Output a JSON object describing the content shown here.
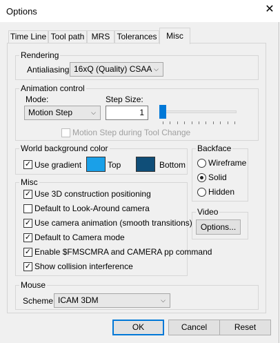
{
  "window": {
    "title": "Options",
    "close_glyph": "✕"
  },
  "tabs": [
    "Time Line",
    "Tool path",
    "MRS",
    "Tolerances",
    "Misc"
  ],
  "active_tab": "Misc",
  "rendering": {
    "label": "Rendering",
    "aa_label": "Antialiasing",
    "aa_value": "16xQ (Quality) CSAA"
  },
  "animation": {
    "label": "Animation control",
    "mode_label": "Mode:",
    "mode_value": "Motion Step",
    "step_label": "Step Size:",
    "step_value": "1",
    "slider_level": 0,
    "during_change_label": "Motion Step during Tool Change",
    "during_change_checked": false,
    "during_change_enabled": false
  },
  "background": {
    "label": "World background color",
    "use_gradient_label": "Use gradient",
    "use_gradient_checked": true,
    "top_label": "Top",
    "top_color": "#1aa0e8",
    "bottom_label": "Bottom",
    "bottom_color": "#0f4e78"
  },
  "backface": {
    "label": "Backface",
    "options": [
      "Wireframe",
      "Solid",
      "Hidden"
    ],
    "selected": "Solid"
  },
  "misc": {
    "label": "Misc",
    "items": [
      {
        "label": "Use 3D construction positioning",
        "checked": true
      },
      {
        "label": "Default to Look-Around camera",
        "checked": false
      },
      {
        "label": "Use camera animation (smooth transitions)",
        "checked": true
      },
      {
        "label": "Default to Camera mode",
        "checked": true
      },
      {
        "label": "Enable $FMSCMRA and CAMERA pp command",
        "checked": true
      },
      {
        "label": "Show collision interference",
        "checked": true
      }
    ]
  },
  "video": {
    "label": "Video",
    "button": "Options..."
  },
  "mouse": {
    "label": "Mouse",
    "scheme_label": "Scheme :",
    "scheme_value": "ICAM 3DM"
  },
  "buttons": {
    "ok": "OK",
    "cancel": "Cancel",
    "reset": "Reset"
  },
  "icons": {
    "check": "✓",
    "combo_arrow": "⌵",
    "close": "close-icon"
  }
}
